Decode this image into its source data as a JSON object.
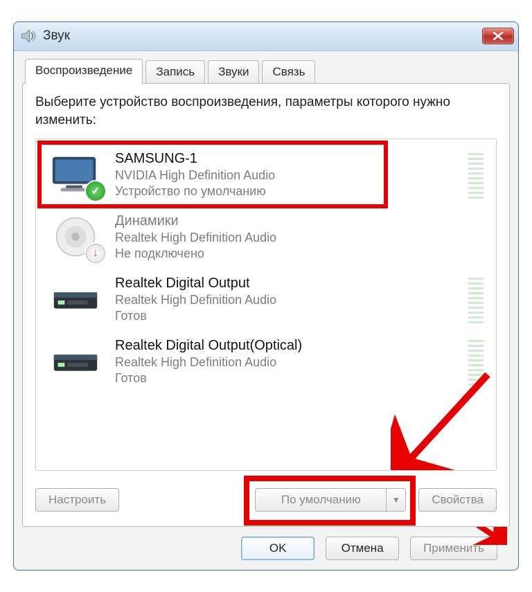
{
  "window": {
    "title": "Звук"
  },
  "tabs": [
    {
      "label": "Воспроизведение",
      "active": true
    },
    {
      "label": "Запись",
      "active": false
    },
    {
      "label": "Звуки",
      "active": false
    },
    {
      "label": "Связь",
      "active": false
    }
  ],
  "instruction": "Выберите устройство воспроизведения, параметры которого нужно изменить:",
  "devices": [
    {
      "name": "SAMSUNG-1",
      "subtitle": "NVIDIA High Definition Audio",
      "status": "Устройство по умолчанию",
      "icon": "monitor",
      "badge": "check",
      "highlighted": true,
      "meter": true
    },
    {
      "name": "Динамики",
      "subtitle": "Realtek High Definition Audio",
      "status": "Не подключено",
      "icon": "speaker",
      "badge": "down",
      "disabled": true,
      "meter": false
    },
    {
      "name": "Realtek Digital Output",
      "subtitle": "Realtek High Definition Audio",
      "status": "Готов",
      "icon": "digital",
      "meter": true
    },
    {
      "name": "Realtek Digital Output(Optical)",
      "subtitle": "Realtek High Definition Audio",
      "status": "Готов",
      "icon": "digital",
      "meter": true
    }
  ],
  "pane_buttons": {
    "configure": "Настроить",
    "set_default": "По умолчанию",
    "properties": "Свойства"
  },
  "dialog_buttons": {
    "ok": "OK",
    "cancel": "Отмена",
    "apply": "Применить"
  },
  "colors": {
    "highlight": "#e60000",
    "accent": "#3a6ea5"
  }
}
